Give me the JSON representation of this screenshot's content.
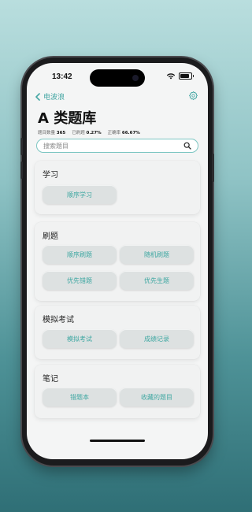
{
  "status_bar": {
    "time": "13:42"
  },
  "nav": {
    "back_label": "电波浪"
  },
  "header": {
    "title": "A 类题库",
    "stats": [
      {
        "label": "题目数量",
        "value": "365"
      },
      {
        "label": "已刷题",
        "value": "0.27%"
      },
      {
        "label": "正确率",
        "value": "66.67%"
      }
    ]
  },
  "search": {
    "placeholder": "搜索题目"
  },
  "sections": [
    {
      "title": "学习",
      "buttons": [
        "顺序学习"
      ]
    },
    {
      "title": "刷题",
      "buttons": [
        "顺序刷题",
        "随机刷题",
        "优先错题",
        "优先生题"
      ]
    },
    {
      "title": "模拟考试",
      "buttons": [
        "模拟考试",
        "成绩记录"
      ]
    },
    {
      "title": "笔记",
      "buttons": [
        "错题本",
        "收藏的题目"
      ]
    }
  ],
  "colors": {
    "accent": "#45a7a4",
    "button_bg": "#dde1e1",
    "card_bg": "#f1f2f2"
  },
  "icons": {
    "back": "chevron-left-icon",
    "settings": "gear-icon",
    "search": "search-icon"
  }
}
